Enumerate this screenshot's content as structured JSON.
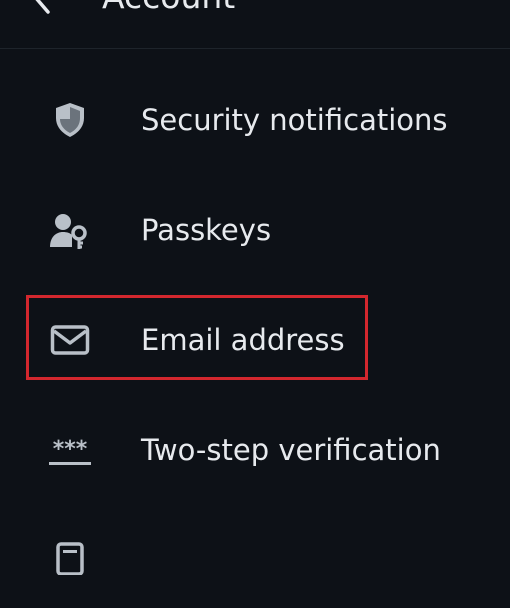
{
  "header": {
    "title": "Account"
  },
  "menu": {
    "items": [
      {
        "icon": "shield-icon",
        "label": "Security notifications"
      },
      {
        "icon": "person-key-icon",
        "label": "Passkeys"
      },
      {
        "icon": "envelope-icon",
        "label": "Email address"
      },
      {
        "icon": "asterisks-icon",
        "label": "Two-step verification"
      },
      {
        "icon": "document-icon",
        "label": ""
      }
    ]
  },
  "colors": {
    "background": "#0d1117",
    "text": "#e7eaee",
    "icon": "#b9c0c8",
    "highlight": "#d3272e"
  }
}
